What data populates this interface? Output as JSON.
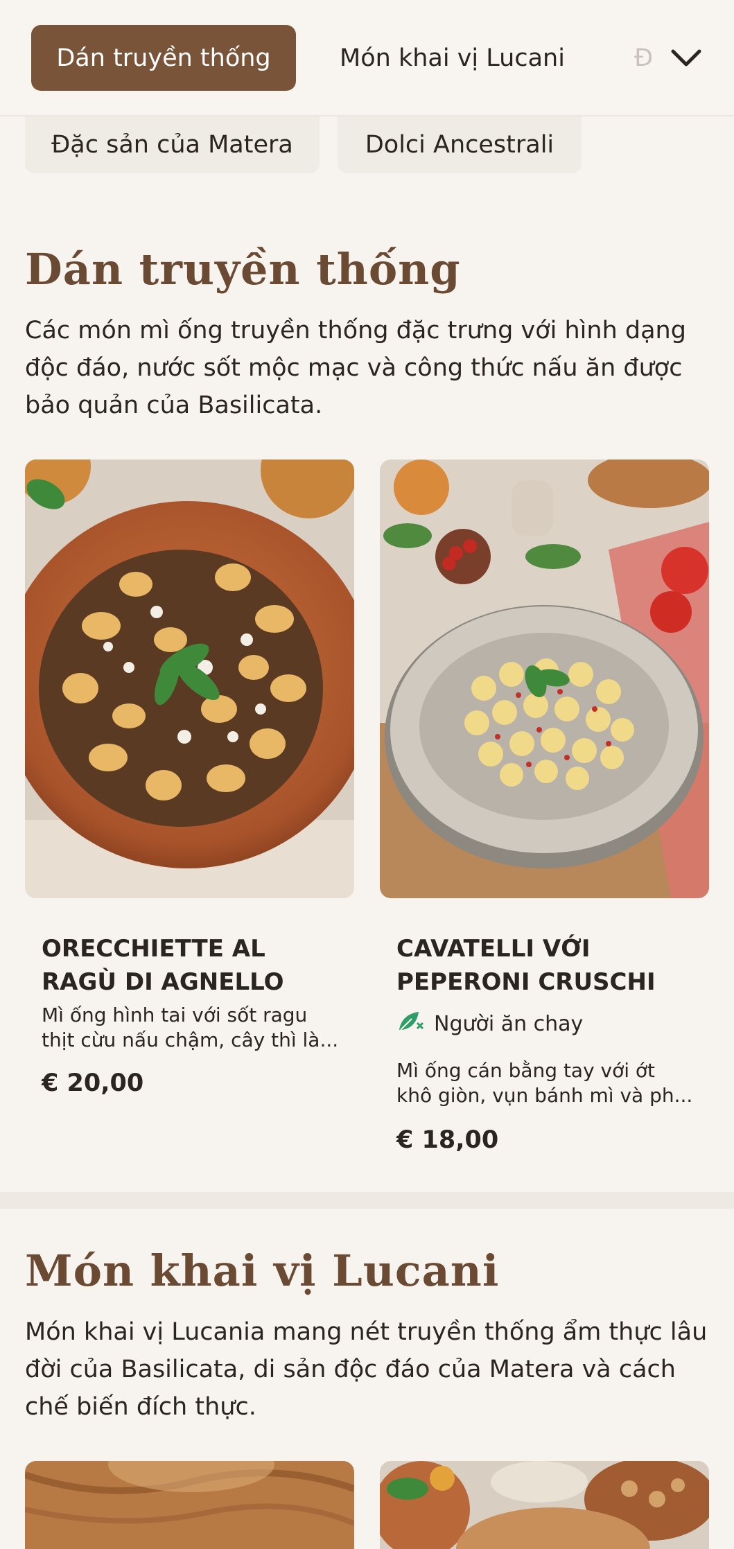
{
  "nav": {
    "tabs": [
      {
        "label": "Dán truyền thống",
        "active": true
      },
      {
        "label": "Món khai vị Lucani",
        "active": false
      },
      {
        "label": "Đ",
        "active": false
      }
    ],
    "tabs_row2": [
      {
        "label": "Đặc sản của Matera"
      },
      {
        "label": "Dolci Ancestrali"
      }
    ],
    "expand_icon": "chevron-down-icon"
  },
  "sections": [
    {
      "title": "Dán truyền thống",
      "description": "Các món mì ống truyền thống đặc trưng với hình dạng độc đáo, nước sốt mộc mạc và công thức nấu ăn được bảo quản của Basilicata.",
      "dishes": [
        {
          "name": "ORECCHIETTE AL RAGÙ DI AGNELLO",
          "description": "Mì ống hình tai với sốt ragu thịt cừu nấu chậm, cây thì là...",
          "price": "€ 20,00",
          "badge": ""
        },
        {
          "name": "CAVATELLI VỚI PEPERONI CRUSCHI",
          "badge": "Người ăn chay",
          "description": "Mì ống cán bằng tay với ớt khô giòn, vụn bánh mì và ph...",
          "price": "€ 18,00"
        }
      ]
    },
    {
      "title": "Món khai vị Lucani",
      "description": "Món khai vị Lucania mang nét truyền thống ẩm thực lâu đời của Basilicata, di sản độc đáo của Matera và cách chế biến đích thực."
    }
  ],
  "colors": {
    "accent": "#7a5439",
    "heading": "#6b4a34",
    "background": "#f7f3ee",
    "vegetarian": "#2e9d6a"
  }
}
